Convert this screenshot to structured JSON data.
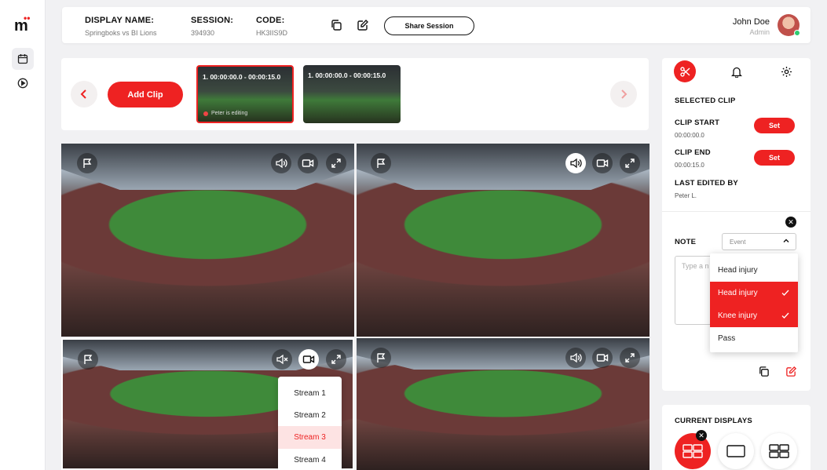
{
  "app": {
    "logo_text": "m"
  },
  "header": {
    "display_name_label": "DISPLAY NAME:",
    "display_name_value": "Springboks vs BI Lions",
    "session_label": "SESSION:",
    "session_value": "394930",
    "code_label": "CODE:",
    "code_value": "HK3IIS9D",
    "share_button": "Share Session",
    "user_name": "John Doe",
    "user_role": "Admin"
  },
  "clips": {
    "add_clip_label": "Add Clip",
    "items": [
      {
        "label": "1. 00:00:00.0 - 00:00:15.0",
        "editing_text": "Peter is editing",
        "active": true
      },
      {
        "label": "1. 00:00:00.0 - 00:00:15.0",
        "editing_text": "",
        "active": false
      }
    ]
  },
  "stream_menu": {
    "items": [
      "Stream 1",
      "Stream 2",
      "Stream 3",
      "Stream 4"
    ],
    "selected": "Stream 3"
  },
  "panel": {
    "selected_clip_title": "SELECTED CLIP",
    "clip_start_label": "CLIP START",
    "clip_start_value": "00:00:00.0",
    "clip_end_label": "CLIP END",
    "clip_end_value": "00:00:15.0",
    "set_label": "Set",
    "last_edited_label": "LAST EDITED BY",
    "last_edited_value": "Peter L.",
    "note_label": "NOTE",
    "event_placeholder": "Event",
    "note_placeholder": "Type a n",
    "event_options": [
      {
        "label": "Head injury",
        "selected": false
      },
      {
        "label": "Head injury",
        "selected": true
      },
      {
        "label": "Knee injury",
        "selected": true
      },
      {
        "label": "Pass",
        "selected": false
      }
    ]
  },
  "current_displays": {
    "title": "CURRENT DISPLAYS"
  },
  "colors": {
    "accent": "#ee2222",
    "selected_bg": "#fde3e3",
    "text": "#111111"
  },
  "icons": [
    "calendar-icon",
    "play-circle-icon",
    "copy-icon",
    "edit-icon",
    "chevron-left-icon",
    "chevron-right-icon",
    "flag-icon",
    "volume-icon",
    "mute-icon",
    "video-camera-icon",
    "expand-icon",
    "scissors-icon",
    "bell-icon",
    "gear-icon",
    "close-icon",
    "chevron-up-icon",
    "check-icon"
  ]
}
